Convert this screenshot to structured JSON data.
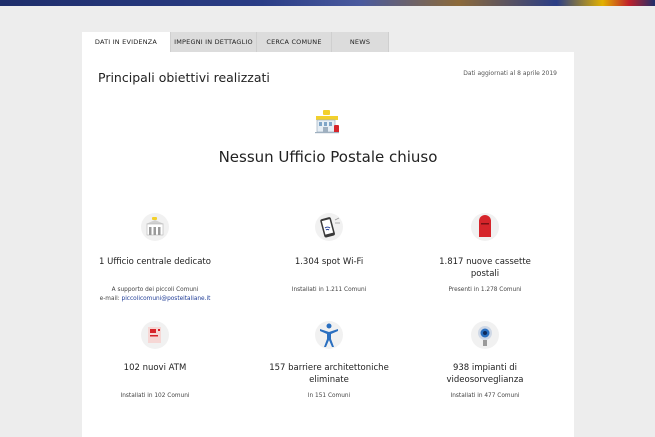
{
  "tabs": [
    "DATI IN EVIDENZA",
    "IMPEGNI IN DETTAGLIO",
    "CERCA COMUNE",
    "NEWS"
  ],
  "card": {
    "title": "Principali obiettivi realizzati",
    "updated": "Dati aggiornati al 8 aprile 2019",
    "hero_text": "Nessun Ufficio Postale chiuso",
    "hero_icon": "post-office-icon"
  },
  "stats": [
    {
      "icon": "post-office-building-icon",
      "label": "1 Ufficio centrale dedicato",
      "sub_line1": "A supporto dei piccoli Comuni",
      "sub_email_prefix": "e-mail: ",
      "sub_email": "piccolicomuni@posteitaliane.it"
    },
    {
      "icon": "smartphone-wifi-icon",
      "label": "1.304 spot Wi-Fi",
      "sub": "Installati in 1.211 Comuni"
    },
    {
      "icon": "mailbox-icon",
      "label_line1": "1.817 nuove cassette",
      "label_line2": "postali",
      "sub": "Presenti in 1.278 Comuni"
    },
    {
      "icon": "atm-icon",
      "label": "102 nuovi ATM",
      "sub": "Installati in 102 Comuni"
    },
    {
      "icon": "accessibility-person-icon",
      "label_line1": "157 barriere architettoniche",
      "label_line2": "eliminate",
      "sub": "In 151 Comuni"
    },
    {
      "icon": "security-camera-icon",
      "label_line1": "938 impianti di",
      "label_line2": "videosorveglianza",
      "sub": "Installati in 477 Comuni"
    }
  ],
  "colors": {
    "accent_blue": "#1f3c96",
    "mailbox_red": "#d6252b",
    "icon_yellow": "#f2d02c"
  }
}
